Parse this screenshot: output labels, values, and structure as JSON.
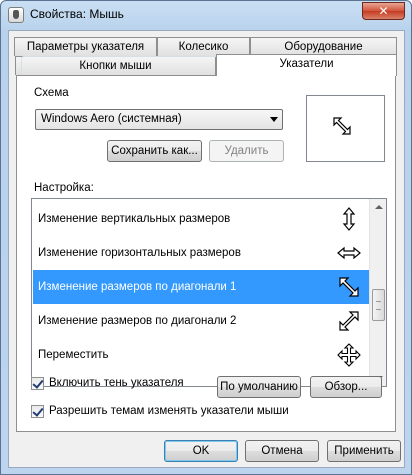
{
  "window": {
    "title": "Свойства: Мышь",
    "close_glyph": "✕"
  },
  "tabs": {
    "row1": [
      "Параметры указателя",
      "Колесико",
      "Оборудование"
    ],
    "row2": [
      "Кнопки мыши",
      "Указатели"
    ],
    "active": "Указатели"
  },
  "scheme": {
    "label": "Схема",
    "selected": "Windows Aero (системная)",
    "save_label": "Сохранить как...",
    "delete_label": "Удалить"
  },
  "preview": {
    "cursor_icon": "diagonal-resize-1-icon"
  },
  "customize": {
    "label": "Настройка:",
    "items": [
      {
        "label": "Изменение вертикальных размеров",
        "icon": "vertical-resize-icon"
      },
      {
        "label": "Изменение горизонтальных размеров",
        "icon": "horizontal-resize-icon"
      },
      {
        "label": "Изменение размеров по диагонали 1",
        "icon": "diagonal-resize-1-icon"
      },
      {
        "label": "Изменение размеров по диагонали 2",
        "icon": "diagonal-resize-2-icon"
      },
      {
        "label": "Переместить",
        "icon": "move-icon"
      }
    ],
    "selected_index": 2
  },
  "options": {
    "shadow_label": "Включить тень указателя",
    "shadow_checked": true,
    "themes_label": "Разрешить темам изменять указатели мыши",
    "themes_checked": true,
    "default_button": "По умолчанию",
    "browse_button": "Обзор..."
  },
  "footer": {
    "ok": "OK",
    "cancel": "Отмена",
    "apply": "Применить"
  }
}
